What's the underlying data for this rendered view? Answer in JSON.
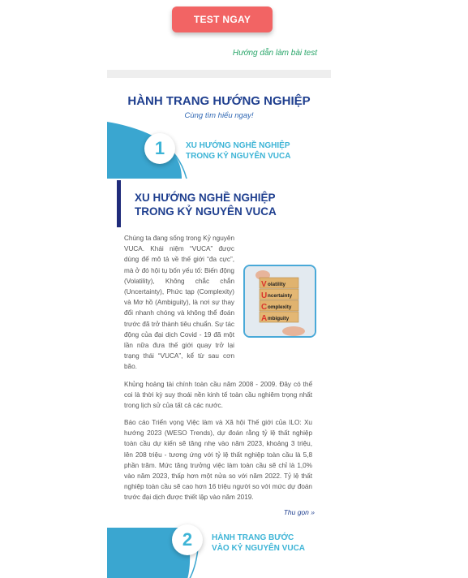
{
  "cta": {
    "label": "TEST NGAY"
  },
  "guide_link": "Hướng dẫn làm bài test",
  "section": {
    "title": "HÀNH TRANG HƯỚNG NGHIỆP",
    "subtitle": "Cùng tìm hiểu ngay!"
  },
  "steps": [
    {
      "number": "1",
      "line1": "XU HƯỚNG NGHỀ NGHIỆP",
      "line2": "TRONG KỶ NGUYÊN VUCA"
    },
    {
      "number": "2",
      "line1": "HÀNH TRANG BƯỚC",
      "line2": "VÀO KỶ NGUYÊN VUCA"
    }
  ],
  "article": {
    "title_line1": "XU HƯỚNG NGHỀ NGHIỆP",
    "title_line2": "TRONG KỶ NGUYÊN VUCA",
    "p1": "Chúng ta đang sống trong Kỷ nguyên VUCA. Khái niệm “VUCA” được dùng để mô tả về thế giới “đa cực”, mà ở đó hội tụ bốn yếu tố: Biến động (Volatility), Không chắc chắn (Uncertainty), Phức tạp (Complexity) và Mơ hồ (Ambiguity), là nơi sự thay đổi nhanh chóng và không thể đoán trước đã trở thành tiêu chuẩn. Sự tác động của đại dịch Covid - 19 đã một lần nữa đưa thế giới quay trở lại trạng thái “VUCA”, kể từ sau cơn bão.",
    "p2": "Khủng hoảng tài chính toàn cầu năm 2008 - 2009. Đây có thể coi là thời kỳ suy thoái nền kinh tế toàn cầu nghiêm trọng nhất trong lịch sử của tất cả các nước.",
    "p3": "Báo cáo Triển vọng Việc làm và Xã hội Thế giới của ILO: Xu hướng 2023 (WESO Trends), dự đoán rằng tỷ lệ thất nghiệp toàn cầu dự kiến sẽ tăng nhẹ vào năm 2023, khoảng 3 triệu, lên 208 triệu - tương ứng với tỷ lệ thất nghiệp toàn cầu là 5,8 phần trăm. Mức tăng trưởng việc làm toàn cầu sẽ chỉ là 1,0% vào năm 2023, thấp hơn một nửa so với năm 2022. Tỷ lệ thất nghiệp toàn cầu sẽ cao hơn 16 triệu người so với mức dự đoán trước đại dịch được thiết lập vào năm 2019.",
    "collapse_label": "Thu gọn »"
  },
  "vuca_image": {
    "letters": [
      "V",
      "U",
      "C",
      "A"
    ],
    "words": [
      "olatility",
      "ncertainty",
      "omplexity",
      "mbiguity"
    ],
    "letter_color": "#d9342b"
  }
}
